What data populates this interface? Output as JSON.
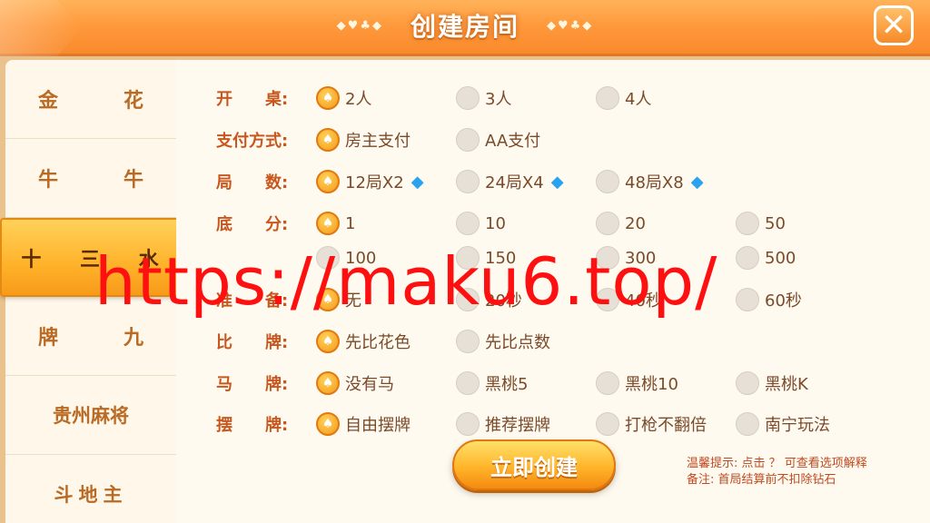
{
  "header": {
    "title": "创建房间",
    "deco_left": "◆♥♣◆",
    "deco_right": "◆♥♣◆",
    "close_glyph": "✕"
  },
  "sidebar": {
    "items": [
      {
        "a": "金",
        "b": "花"
      },
      {
        "a": "牛",
        "b": "牛"
      },
      {
        "a": "十",
        "b": "三",
        "c": "水"
      },
      {
        "a": "牌",
        "b": "九"
      },
      {
        "label": "贵州麻将"
      },
      {
        "label": "斗地主"
      }
    ],
    "active_index": 2
  },
  "rows": {
    "players": {
      "label": "开　　桌:",
      "options": [
        "2人",
        "3人",
        "4人"
      ],
      "selected": 0
    },
    "payment": {
      "label": "支付方式:",
      "options": [
        "房主支付",
        "AA支付"
      ],
      "selected": 0
    },
    "rounds": {
      "label": "局　　数:",
      "options": [
        "12局X2",
        "24局X4",
        "48局X8"
      ],
      "selected": 0
    },
    "base": {
      "label": "底　　分:",
      "options": [
        "1",
        "10",
        "20",
        "50",
        "100",
        "150",
        "300",
        "500"
      ],
      "selected": 0
    },
    "prepare": {
      "label": "准　　备:",
      "options": [
        "无",
        "20秒",
        "40秒",
        "60秒"
      ],
      "selected": 0
    },
    "compare": {
      "label": "比　　牌:",
      "options": [
        "先比花色",
        "先比点数"
      ],
      "selected": 0
    },
    "horse": {
      "label": "马　　牌:",
      "options": [
        "没有马",
        "黑桃5",
        "黑桃10",
        "黑桃K"
      ],
      "selected": 0
    },
    "arrange": {
      "label": "摆　　牌:",
      "options": [
        "自由摆牌",
        "推荐摆牌",
        "打枪不翻倍",
        "南宁玩法"
      ],
      "selected": 0
    }
  },
  "create_button": "立即创建",
  "tips": {
    "line1": "温馨提示: 点击 ？ 可查看选项解释",
    "line2": "备注: 首局结算前不扣除钻石"
  },
  "watermark": "https://maku6.top/",
  "colors": {
    "header": "#ff9a3d",
    "label": "#c8571e",
    "accent": "#ffb22a",
    "watermark": "#ff1010",
    "gem": "#29a3f0"
  },
  "icons": {
    "close": "close-icon",
    "selected_radio": "spade-radio-icon",
    "diamond": "diamond-icon"
  }
}
